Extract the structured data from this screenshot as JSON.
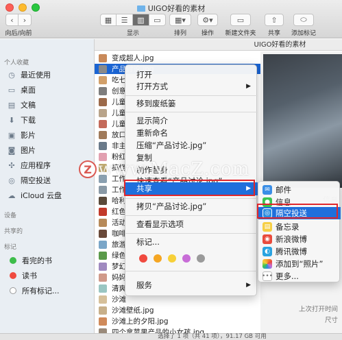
{
  "window": {
    "title": "UIGO好看的素材"
  },
  "toolbar": {
    "nav_label": "向后/向前",
    "display_label": "显示",
    "sort_label": "排列",
    "action_label": "操作",
    "new_folder_label": "新建文件夹",
    "share_label": "共享",
    "add_tag_label": "添加标记"
  },
  "pathbar": {
    "text": "UIGO好看的素材"
  },
  "sidebar": {
    "favorites_header": "个人收藏",
    "items": [
      {
        "label": "最近使用",
        "icon": "clock-icon"
      },
      {
        "label": "桌面",
        "icon": "desktop-icon"
      },
      {
        "label": "文稿",
        "icon": "document-icon"
      },
      {
        "label": "下载",
        "icon": "download-icon"
      },
      {
        "label": "影片",
        "icon": "film-icon"
      },
      {
        "label": "图片",
        "icon": "camera-icon"
      },
      {
        "label": "应用程序",
        "icon": "apps-icon"
      },
      {
        "label": "隔空投送",
        "icon": "airdrop-icon"
      },
      {
        "label": "iCloud 云盘",
        "icon": "cloud-icon"
      }
    ],
    "devices_header": "设备",
    "shared_header": "共享的",
    "tags_header": "标记",
    "tags": [
      {
        "label": "看完的书",
        "color": "#3dbd4a"
      },
      {
        "label": "读书",
        "color": "#f04a3f"
      },
      {
        "label": "所有标记...",
        "color": "#9a9a9a"
      }
    ]
  },
  "files": [
    {
      "name": "变成超人.jpg",
      "thumb": "#c98a5a"
    },
    {
      "name": "产品讨论.jpg",
      "thumb": "#8a8a8a",
      "selected": true
    },
    {
      "name": "吃七",
      "thumb": "#d2a06a"
    },
    {
      "name": "创意",
      "thumb": "#7e7e7e"
    },
    {
      "name": "儿童",
      "thumb": "#9c6a4a"
    },
    {
      "name": "儿童",
      "thumb": "#b9a48a"
    },
    {
      "name": "儿童",
      "thumb": "#c46a5a"
    },
    {
      "name": "放口",
      "thumb": "#a07a5a"
    },
    {
      "name": "非主",
      "thumb": "#6a7a8a"
    },
    {
      "name": "粉红",
      "thumb": "#e2a0b0"
    },
    {
      "name": "搞怪",
      "thumb": "#c0aa70"
    },
    {
      "name": "工作",
      "thumb": "#8aa0b0"
    },
    {
      "name": "工作",
      "thumb": "#8a9aa6"
    },
    {
      "name": "哈利",
      "thumb": "#5a4a3a"
    },
    {
      "name": "红色",
      "thumb": "#c23a2a"
    },
    {
      "name": "活动",
      "thumb": "#b78a5a"
    },
    {
      "name": "咖啡",
      "thumb": "#6a4a3a"
    },
    {
      "name": "旅游",
      "thumb": "#7aa6c8"
    },
    {
      "name": "绿色",
      "thumb": "#5a9a4a"
    },
    {
      "name": "梦幻",
      "thumb": "#a08ac0"
    },
    {
      "name": "妈妈",
      "thumb": "#d09a8a"
    },
    {
      "name": "清爽",
      "thumb": "#9ac6c2"
    },
    {
      "name": "沙滩",
      "thumb": "#d6c09a"
    },
    {
      "name": "沙滩壁纸.jpg",
      "thumb": "#c8b08a"
    },
    {
      "name": "沙滩上的夕阳.jpg",
      "thumb": "#d08a5a"
    },
    {
      "name": "四个拿苹果产品的小女孩.jpg",
      "thumb": "#9a8a7a"
    },
    {
      "name": "躺在草地上的美女.jpg",
      "thumb": "#7a9a5a"
    }
  ],
  "context_menu": {
    "items": [
      {
        "label": "打开"
      },
      {
        "label": "打开方式",
        "submenu": true
      },
      {
        "label": "移到废纸篓"
      },
      {
        "label": "显示简介"
      },
      {
        "label": "重新命名"
      },
      {
        "label": "压缩“产品讨论.jpg”"
      },
      {
        "label": "复制"
      },
      {
        "label": "制作替身"
      },
      {
        "label": "快速查看“产品讨论.jpg”"
      },
      {
        "label": "共享",
        "submenu": true
      },
      {
        "label": "拷贝“产品讨论.jpg”"
      },
      {
        "label": "查看显示选项"
      },
      {
        "label": "标记..."
      },
      {
        "label": "服务",
        "submenu": true
      }
    ],
    "tag_colors": [
      "#f04a3f",
      "#f5a623",
      "#f7d038",
      "#c86dd7",
      "#9a9a9a"
    ]
  },
  "share_submenu": {
    "items": [
      {
        "label": "邮件",
        "icon": "mail-icon",
        "color": "#3a8ee6"
      },
      {
        "label": "信息",
        "icon": "messages-icon",
        "color": "#3cc451"
      },
      {
        "label": "隔空投送",
        "icon": "airdrop-icon",
        "color": "#2c8de0",
        "active": true
      },
      {
        "label": "备忘录",
        "icon": "notes-icon",
        "color": "#f6cf45"
      },
      {
        "label": "新浪微博",
        "icon": "weibo-icon",
        "color": "#e94b3c"
      },
      {
        "label": "腾讯微博",
        "icon": "tencent-weibo-icon",
        "color": "#2aa3e0"
      },
      {
        "label": "添加到“照片”",
        "icon": "photos-icon",
        "color": "#f59c2a"
      },
      {
        "label": "更多...",
        "icon": "more-icon",
        "color": "#9a9a9a"
      }
    ]
  },
  "preview": {
    "name_label": "信息",
    "last_opened_label": "上次打开时间",
    "size_label": "尺寸"
  },
  "status": {
    "text": "选择了 1 项（共 41 项），91.17 GB 可用"
  },
  "watermark": {
    "text": "www.MacZ.com",
    "badge": "Z"
  }
}
